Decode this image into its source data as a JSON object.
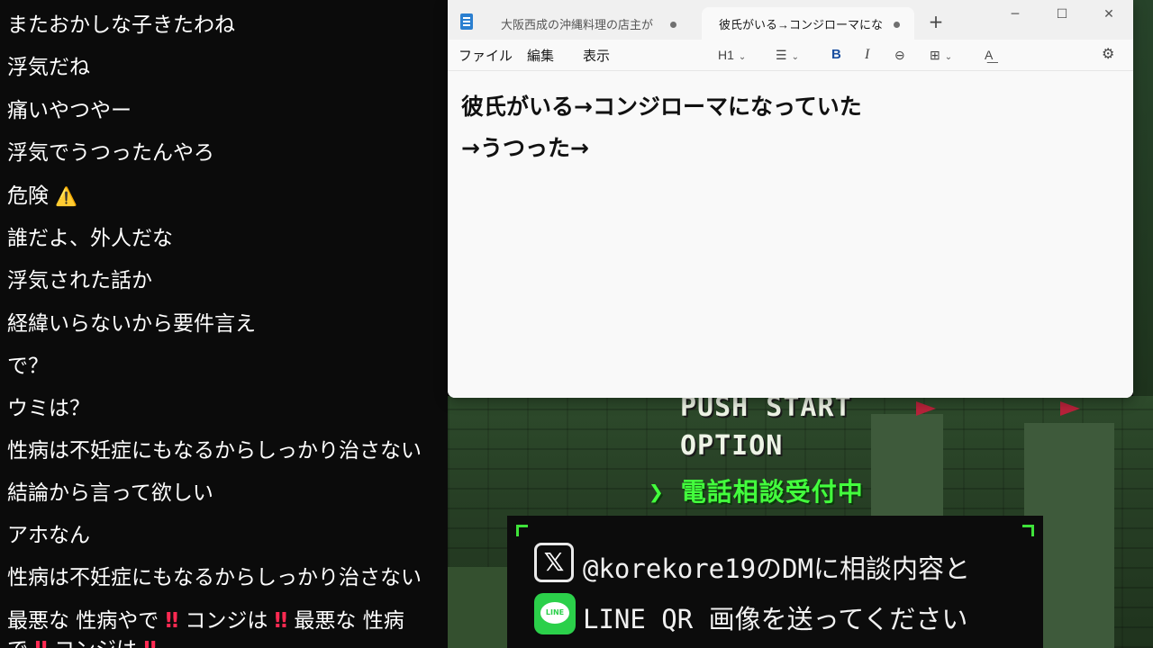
{
  "chat": {
    "messages": [
      "またおかしな子きたわね",
      "浮気だね",
      "痛いやつやー",
      "浮気でうつったんやろ",
      "危険",
      "誰だよ、外人だな",
      "浮気された話か",
      "経緯いらないから要件言え",
      "で？",
      "ウミは？",
      "性病は不妊症にもなるからしっかり治さない",
      "結論から言って欲しい",
      "アホなん",
      "性病は不妊症にもなるからしっかり治さない"
    ],
    "warning_glyph": "⚠️",
    "last_message": {
      "part1": "最悪な 性病やで",
      "bang": "‼",
      "part2": "コンジは",
      "part3": "最悪な 性病"
    },
    "cut_line": {
      "part1": "で",
      "part2": "コンジは"
    }
  },
  "notepad": {
    "tabs": [
      {
        "label": "大阪西成の沖縄料理の店主が",
        "active": false
      },
      {
        "label": "彼氏がいる→コンジローマになってい",
        "active": true
      }
    ],
    "new_tab": "+",
    "window_controls": {
      "minimize": "─",
      "maximize": "☐",
      "close": "✕"
    },
    "menu": [
      "ファイル",
      "編集",
      "表示"
    ],
    "toolbar": {
      "heading": "H1",
      "list": "☰",
      "bold": "B",
      "italic": "I",
      "link": "⊖",
      "table": "⊞",
      "spell": "A͟",
      "settings": "⚙"
    },
    "content": [
      "彼氏がいる→コンジローマになっていた",
      "→うつった→"
    ]
  },
  "game": {
    "menu": [
      "PUSH START",
      "OPTION"
    ],
    "selected": "電話相談受付中",
    "cursor": "❯",
    "info": {
      "x_line": "@korekore19のDMに相談内容と",
      "line_line": "LINE QR 画像を送ってください",
      "x_icon": "𝕏",
      "line_icon_text": "LINE"
    }
  },
  "colors": {
    "chat_bg": "#0b0b0b",
    "chat_text": "#ffffff",
    "game_green": "#43ff3d",
    "line_green": "#2bd04a",
    "alert_red": "#ff2a52"
  }
}
